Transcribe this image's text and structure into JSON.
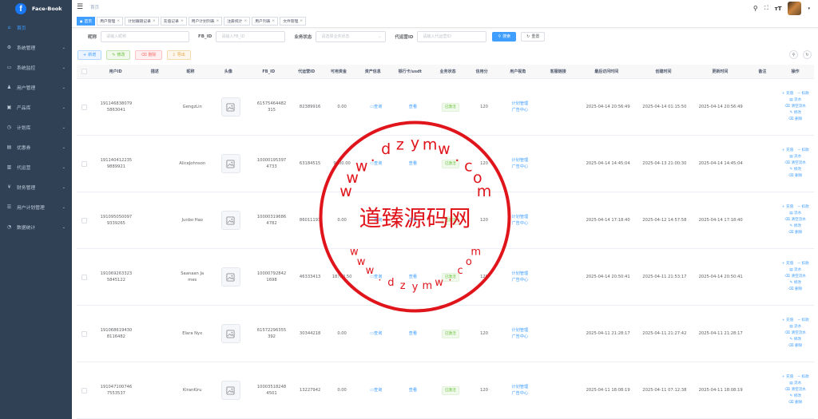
{
  "app": {
    "name": "Face-Book",
    "logo_letter": "f"
  },
  "sidebar": {
    "items": [
      {
        "label": "首页",
        "icon": "home-icon",
        "glyph": "⌂",
        "active": true,
        "arrow": false
      },
      {
        "label": "系统管理",
        "icon": "gear-icon",
        "glyph": "⚙",
        "active": false,
        "arrow": true
      },
      {
        "label": "系统监控",
        "icon": "monitor-icon",
        "glyph": "▭",
        "active": false,
        "arrow": true
      },
      {
        "label": "用户管理",
        "icon": "user-icon",
        "glyph": "♟",
        "active": false,
        "arrow": true
      },
      {
        "label": "产品库",
        "icon": "box-icon",
        "glyph": "▣",
        "active": false,
        "arrow": true
      },
      {
        "label": "计划库",
        "icon": "clock-icon",
        "glyph": "◷",
        "active": false,
        "arrow": true
      },
      {
        "label": "优惠券",
        "icon": "coupon-icon",
        "glyph": "▤",
        "active": false,
        "arrow": true
      },
      {
        "label": "代运营",
        "icon": "document-icon",
        "glyph": "▥",
        "active": false,
        "arrow": true
      },
      {
        "label": "财务管理",
        "icon": "yen-icon",
        "glyph": "¥",
        "active": false,
        "arrow": true
      },
      {
        "label": "用户计划管理",
        "icon": "list-icon",
        "glyph": "☰",
        "active": false,
        "arrow": true
      },
      {
        "label": "数据统计",
        "icon": "chart-icon",
        "glyph": "◔",
        "active": false,
        "arrow": true
      }
    ]
  },
  "header": {
    "breadcrumb": "首页"
  },
  "tags": [
    {
      "label": "首页",
      "active": true,
      "closable": false
    },
    {
      "label": "用户管理",
      "active": false,
      "closable": true
    },
    {
      "label": "计划跟随记录",
      "active": false,
      "closable": true
    },
    {
      "label": "充值记录",
      "active": false,
      "closable": true
    },
    {
      "label": "用户计划列表",
      "active": false,
      "closable": true
    },
    {
      "label": "注册统计",
      "active": false,
      "closable": true
    },
    {
      "label": "用户列表",
      "active": false,
      "closable": true
    },
    {
      "label": "文件管理",
      "active": false,
      "closable": true
    }
  ],
  "search": {
    "nickname_label": "昵称",
    "nickname_placeholder": "请输入昵称",
    "fbid_label": "FB_ID",
    "fbid_placeholder": "请输入FB_ID",
    "status_label": "业务状态",
    "status_placeholder": "请选择业务状态",
    "agent_label": "代运营ID",
    "agent_placeholder": "请输入代运营ID",
    "search_button": "搜索",
    "reset_button": "重置"
  },
  "toolbar": {
    "add": "新增",
    "edit": "修改",
    "delete": "删除",
    "export": "导出"
  },
  "table": {
    "columns": [
      "用户ID",
      "描述",
      "昵称",
      "头像",
      "FB_ID",
      "代运营ID",
      "可用资金",
      "资产信息",
      "银行卡/usdt",
      "业务状态",
      "信用分",
      "用户视角",
      "客服链接",
      "最后访问时间",
      "创建时间",
      "更新时间",
      "备注",
      "操作"
    ],
    "rows": [
      {
        "user_id": "1911468380795863041",
        "nickname": "GengzLin",
        "fb_id": "61575464482315",
        "agent_id": "82389916",
        "funds": "0.00",
        "asset": "查询",
        "bank": "查看",
        "status": "已激活",
        "credit": "120",
        "view1": "计划管理",
        "view2": "广告中心",
        "last": "2025-04-14 20:56:49",
        "created": "2025-04-14 01:15:50",
        "updated": "2025-04-14 20:56:49"
      },
      {
        "user_id": "1911404122359889921",
        "nickname": "AliceJohnson",
        "fb_id": "100001953974733",
        "agent_id": "63184515",
        "funds": "9000.00",
        "asset": "查询",
        "bank": "查看",
        "status": "已激活",
        "credit": "120",
        "view1": "计划管理",
        "view2": "广告中心",
        "last": "2025-04-14 14:45:04",
        "created": "2025-04-13 21:00:30",
        "updated": "2025-04-14 14:45:04"
      },
      {
        "user_id": "1910950500979339265",
        "nickname": "Junbo Hao",
        "fb_id": "100003196864782",
        "agent_id": "86011193",
        "funds": "0.00",
        "asset": "查询",
        "bank": "查看",
        "status": "已激活",
        "credit": "120",
        "view1": "计划管理",
        "view2": "广告中心",
        "last": "2025-04-14 17:18:40",
        "created": "2025-04-12 14:57:58",
        "updated": "2025-04-14 17:18:40"
      },
      {
        "user_id": "1910692633235845122",
        "nickname": "Saanaan James",
        "fb_id": "100007928421698",
        "agent_id": "46333413",
        "funds": "18730.50",
        "asset": "查询",
        "bank": "查看",
        "status": "已激活",
        "credit": "120",
        "view1": "计划管理",
        "view2": "广告中心",
        "last": "2025-04-14 20:50:41",
        "created": "2025-04-11 21:53:17",
        "updated": "2025-04-14 20:50:41"
      },
      {
        "user_id": "1910686194308116482",
        "nickname": "Elara Nyx",
        "fb_id": "61572296355392",
        "agent_id": "30344218",
        "funds": "0.00",
        "asset": "查询",
        "bank": "查看",
        "status": "已激活",
        "credit": "120",
        "view1": "计划管理",
        "view2": "广告中心",
        "last": "2025-04-11 21:28:17",
        "created": "2025-04-11 21:27:42",
        "updated": "2025-04-11 21:28:17"
      },
      {
        "user_id": "1910471007467553537",
        "nickname": "KiranKiru",
        "fb_id": "100035182484501",
        "agent_id": "13227942",
        "funds": "0.00",
        "asset": "查询",
        "bank": "查看",
        "status": "已激活",
        "credit": "120",
        "view1": "计划管理",
        "view2": "广告中心",
        "last": "2025-04-11 18:08:19",
        "created": "2025-04-11 07:12:38",
        "updated": "2025-04-11 18:08:19"
      }
    ],
    "ops": {
      "recharge": "充值",
      "deduct": "扣款",
      "bill": "流水",
      "clear": "清空流水",
      "edit": "修改",
      "delete": "删除"
    }
  },
  "watermark": {
    "text": "道臻源码网",
    "url": "www.dzymw.com",
    "color": "#e0141b"
  }
}
